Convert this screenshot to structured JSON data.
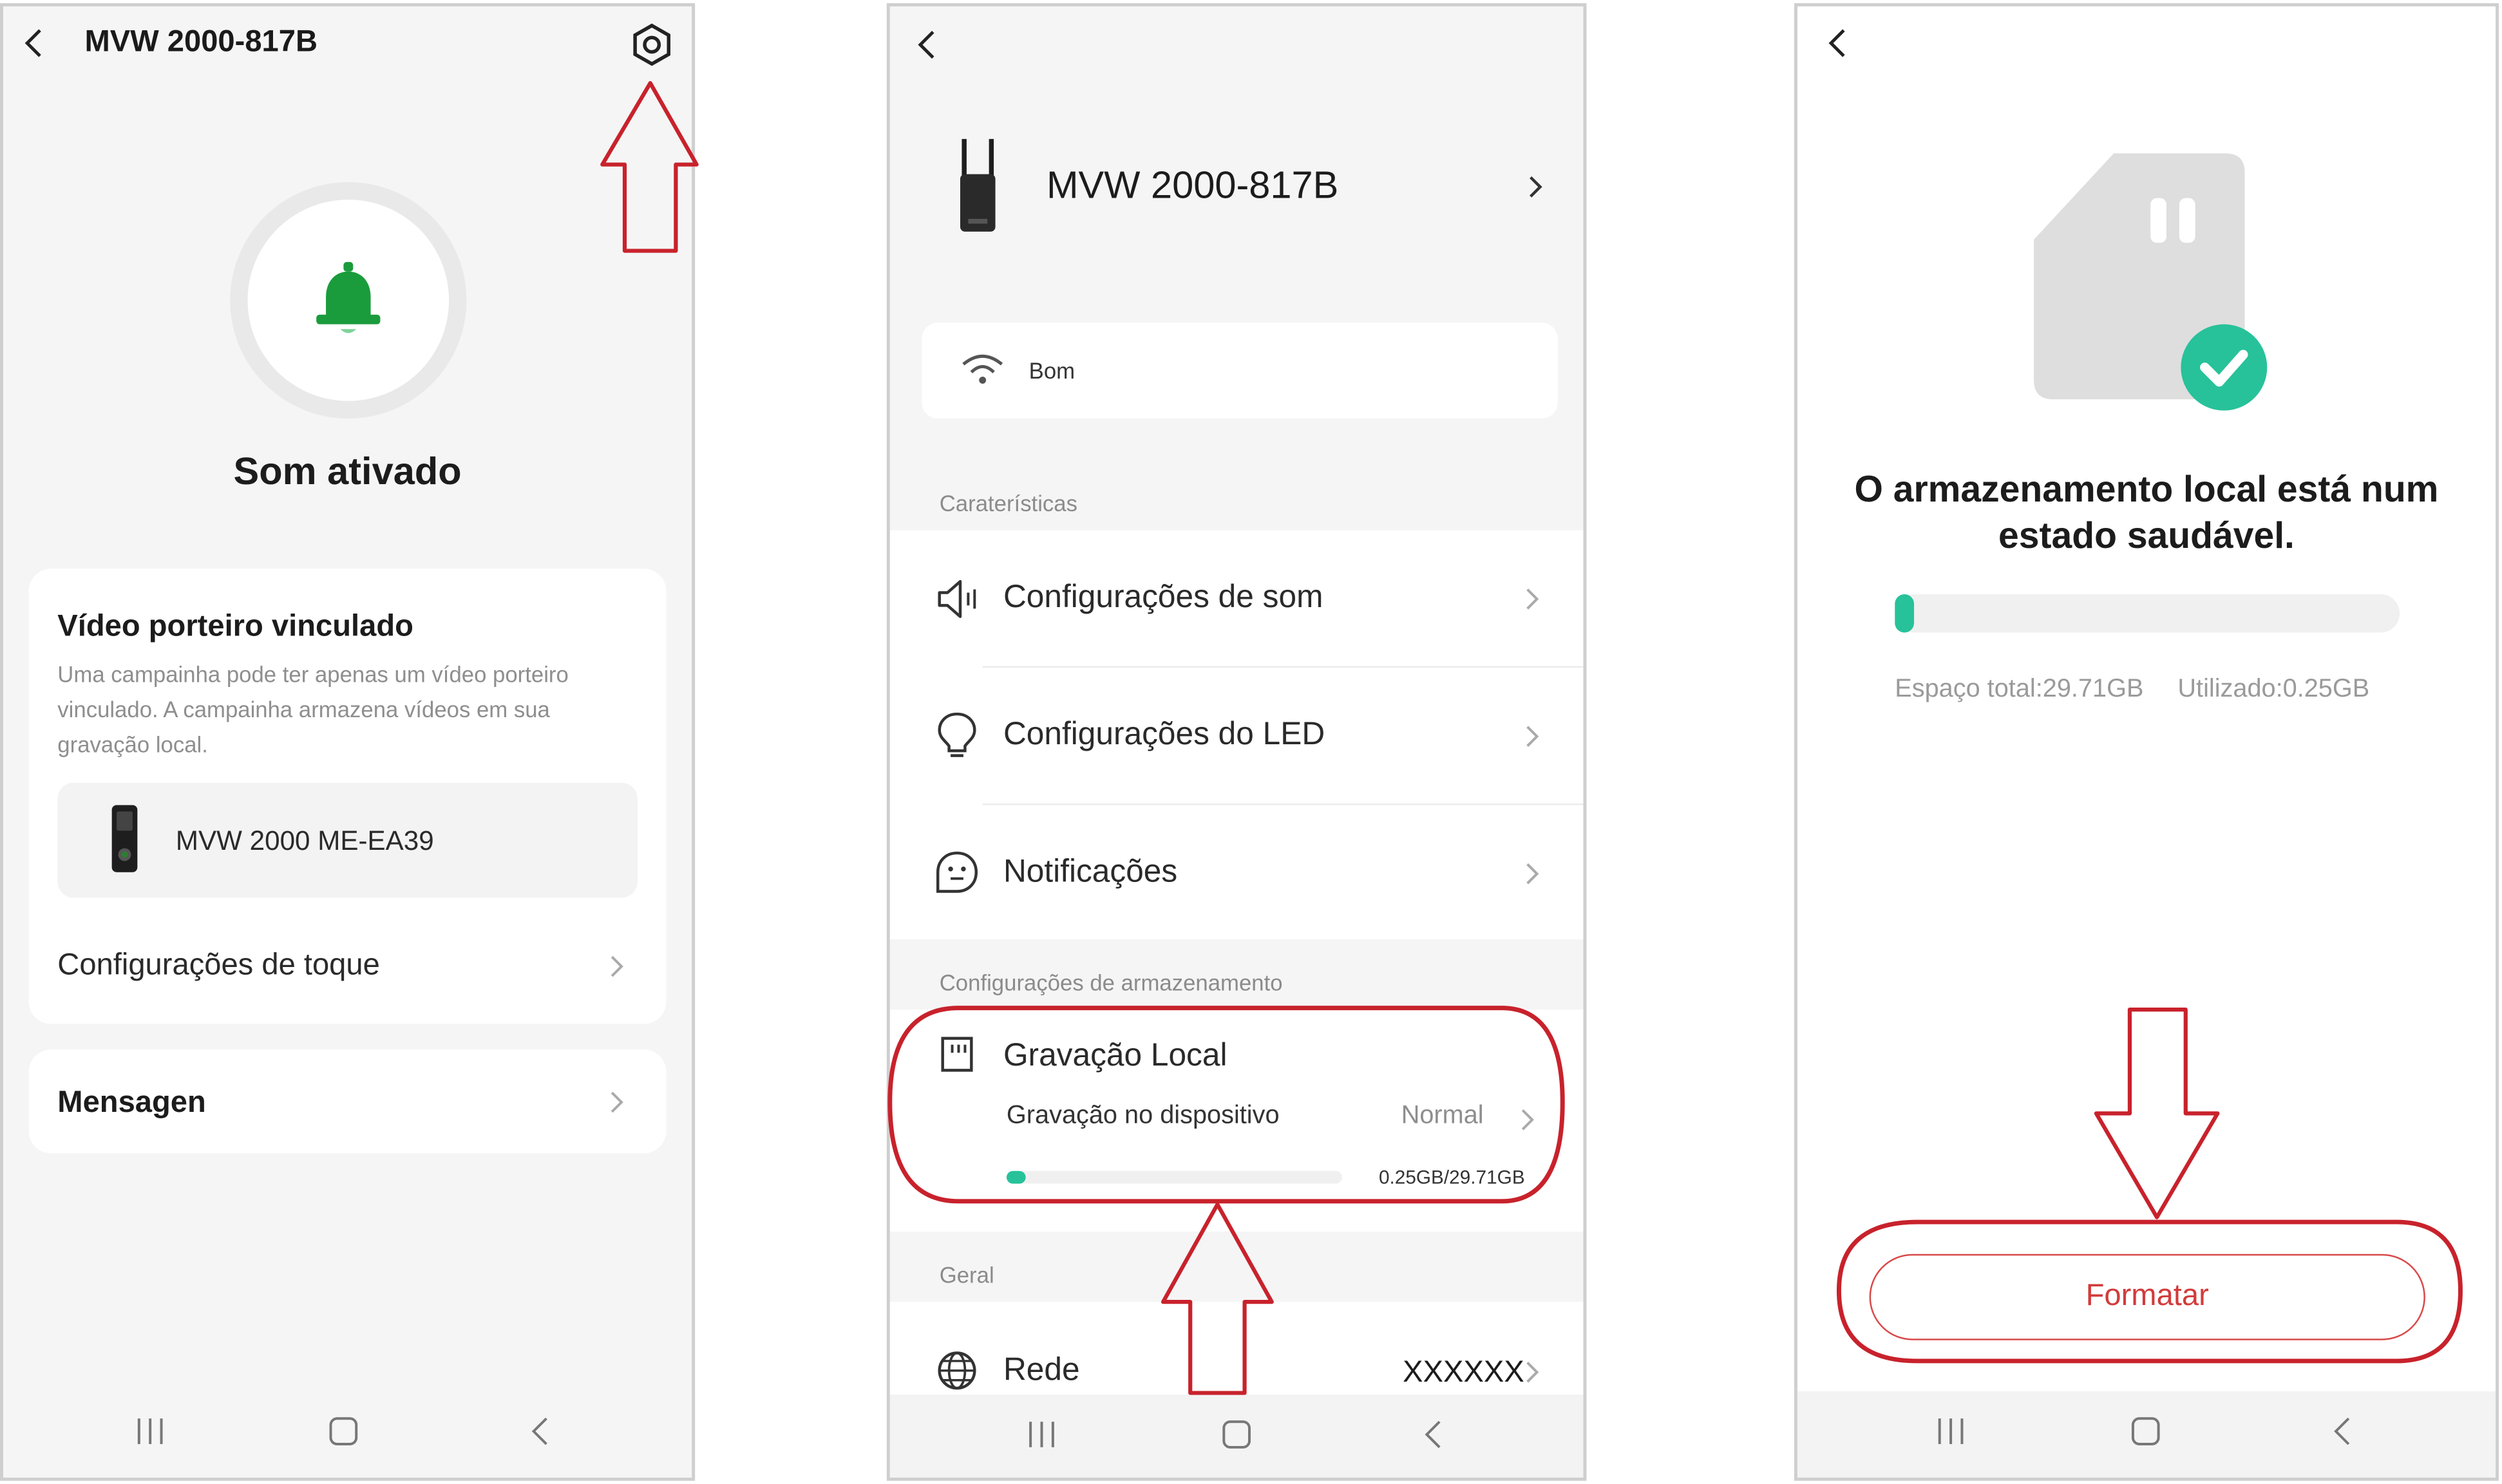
{
  "accent_color": "#27c29a",
  "annotation_color": "#c8222c",
  "bell_color": "#1a9c3c",
  "screen1": {
    "title": "MVW 2000-817B",
    "sound_status": "Som ativado",
    "linked_card": {
      "title": "Vídeo porteiro vinculado",
      "description": "Uma campainha pode ter apenas um vídeo porteiro vinculado. A campainha armazena vídeos em sua gravação local.",
      "device_name": "MVW 2000 ME-EA39",
      "ringtone_settings": "Configurações de toque"
    },
    "messages_label": "Mensagen"
  },
  "screen2": {
    "device_name": "MVW 2000-817B",
    "signal_label": "Bom",
    "features_section": "Caraterísticas",
    "menu": [
      {
        "label": "Configurações de som",
        "icon": "speaker-icon"
      },
      {
        "label": "Configurações do LED",
        "icon": "bulb-icon"
      },
      {
        "label": "Notificações",
        "icon": "notification-icon"
      }
    ],
    "storage_section": "Configurações de armazenamento",
    "local_recording": {
      "title": "Gravação Local",
      "subtitle": "Gravação no dispositivo",
      "status": "Normal",
      "usage_text": "0.25GB/29.71GB",
      "used_fraction": 0.0084
    },
    "general_section": "Geral",
    "network": {
      "label": "Rede",
      "value": "XXXXXX"
    }
  },
  "screen3": {
    "status_message": "O armazenamento local está num estado saudável.",
    "total_space": "Espaço total:29.71GB",
    "used_space": "Utilizado:0.25GB",
    "used_fraction": 0.0084,
    "format_button": "Formatar"
  }
}
